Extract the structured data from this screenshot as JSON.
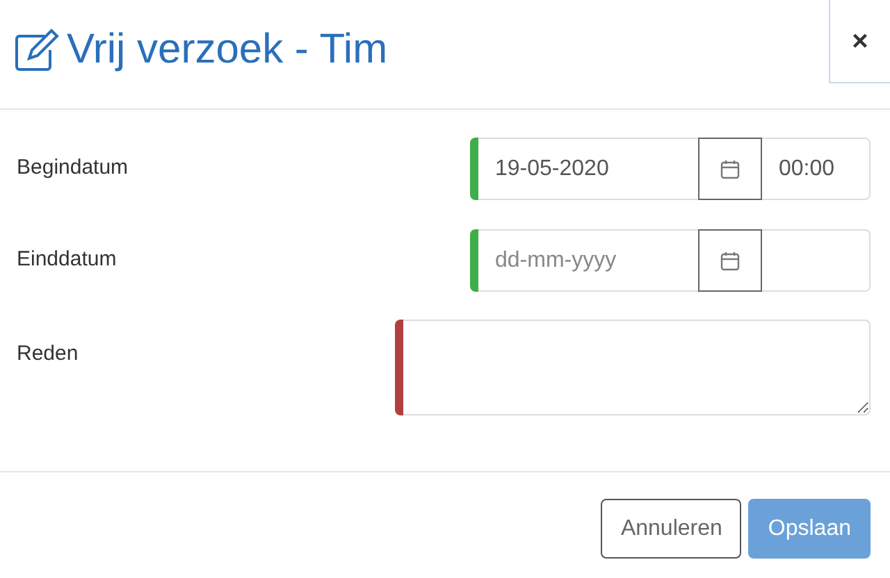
{
  "dialog": {
    "title": "Vrij verzoek - Tim",
    "close": "×"
  },
  "fields": [
    {
      "kind": "datetime",
      "label": "Begindatum",
      "value": "19-05-2020",
      "time": "00:00",
      "color": "#3fae49"
    },
    {
      "kind": "datetime",
      "label": "Einddatum",
      "placeholder": "dd-mm-yyyy",
      "color": "#3fae49"
    },
    {
      "kind": "textarea",
      "label": "Reden",
      "color": "#b04040"
    }
  ],
  "buttons": [
    {
      "label": "Annuleren",
      "kind": "secondary",
      "disabled": false
    },
    {
      "label": "Opslaan",
      "kind": "primary",
      "disabled": true
    }
  ]
}
